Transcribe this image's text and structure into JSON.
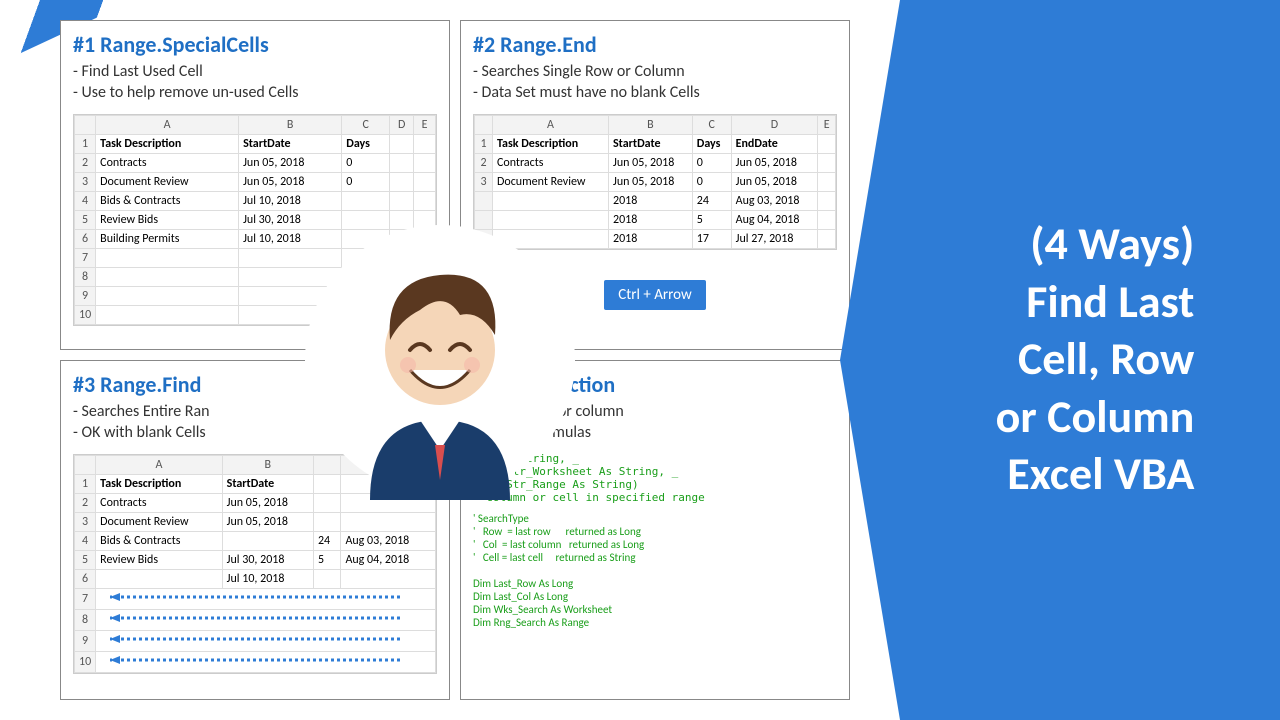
{
  "right_panel": {
    "line1": "(4 Ways)",
    "line2": "Find Last",
    "line3": "Cell, Row",
    "line4": "or Column",
    "line5": "Excel VBA"
  },
  "q1": {
    "title": "#1 Range.SpecialCells",
    "b1": "- Find Last Used Cell",
    "b2": "- Use to help remove un-used Cells",
    "cols": [
      "A",
      "B",
      "C",
      "D",
      "E"
    ],
    "h": [
      "Task Description",
      "StartDate",
      "Days",
      "",
      ""
    ],
    "rows": [
      [
        "Contracts",
        "Jun 05, 2018",
        "0",
        "",
        ""
      ],
      [
        "Document Review",
        "Jun 05, 2018",
        "0",
        "",
        ""
      ],
      [
        "Bids & Contracts",
        "Jul 10, 2018",
        "",
        "",
        ""
      ],
      [
        "Review Bids",
        "Jul 30, 2018",
        "",
        "",
        ""
      ],
      [
        "Building Permits",
        "Jul 10, 2018",
        "",
        "",
        ""
      ],
      [
        "",
        "",
        "",
        "",
        ""
      ],
      [
        "",
        "",
        "",
        "",
        ""
      ],
      [
        "",
        "",
        "",
        "",
        ""
      ],
      [
        "",
        "",
        "",
        "",
        ""
      ]
    ]
  },
  "q2": {
    "title": "#2 Range.End",
    "b1": "- Searches Single Row or Column",
    "b2": "- Data Set must have no blank Cells",
    "cols": [
      "A",
      "B",
      "C",
      "D",
      "E"
    ],
    "h": [
      "Task Description",
      "StartDate",
      "Days",
      "EndDate",
      ""
    ],
    "rows": [
      [
        "Contracts",
        "Jun 05, 2018",
        "0",
        "Jun 05, 2018",
        ""
      ],
      [
        "Document Review",
        "Jun 05, 2018",
        "0",
        "Jun 05, 2018",
        ""
      ],
      [
        "",
        "",
        "2018",
        "24",
        "Aug 03, 2018"
      ],
      [
        "",
        "",
        "2018",
        "5",
        "Aug 04, 2018"
      ],
      [
        "",
        "",
        "2018",
        "17",
        "Jul 27, 2018"
      ]
    ],
    "badge": "Ctrl + Arrow"
  },
  "q3": {
    "title": "#3 Range.Find",
    "b1": "- Searches Entire Ran",
    "b2": "- OK with blank Cells",
    "cols": [
      "A",
      "B",
      "",
      "",
      ""
    ],
    "h": [
      "Task Description",
      "StartDate",
      "",
      "",
      ""
    ],
    "rows": [
      [
        "Contracts",
        "Jun 05, 2018",
        "",
        "",
        ""
      ],
      [
        "Document Review",
        "Jun 05, 2018",
        "",
        "",
        ""
      ],
      [
        "Bids & Contracts",
        "",
        "24",
        "Aug 03, 2018",
        ""
      ],
      [
        "Review Bids",
        "Jul 30, 2018",
        "5",
        "Aug 04, 2018",
        ""
      ],
      [
        "",
        "Jul 10, 2018",
        "",
        "",
        ""
      ],
      [
        "",
        "",
        "",
        "",
        ""
      ],
      [
        "",
        "",
        "",
        "",
        ""
      ],
      [
        "",
        "",
        "",
        "",
        ""
      ],
      [
        "",
        "",
        "",
        "",
        ""
      ]
    ]
  },
  "q4": {
    "title": "efined Function",
    "b1": "last cell, row or column",
    "b2": "orksheet formulas",
    "code1": "ype As String, _\n  al Str_Worksheet As String, _\n  al Str_Range As String)\n  column or cell in specified range",
    "code2": "' SearchType\n'   Row  = last row      returned as Long\n'   Col  = last column   returned as Long\n'   Cell = last cell     returned as String\n\nDim Last_Row As Long\nDim Last_Col As Long\nDim Wks_Search As Worksheet\nDim Rng_Search As Range"
  }
}
